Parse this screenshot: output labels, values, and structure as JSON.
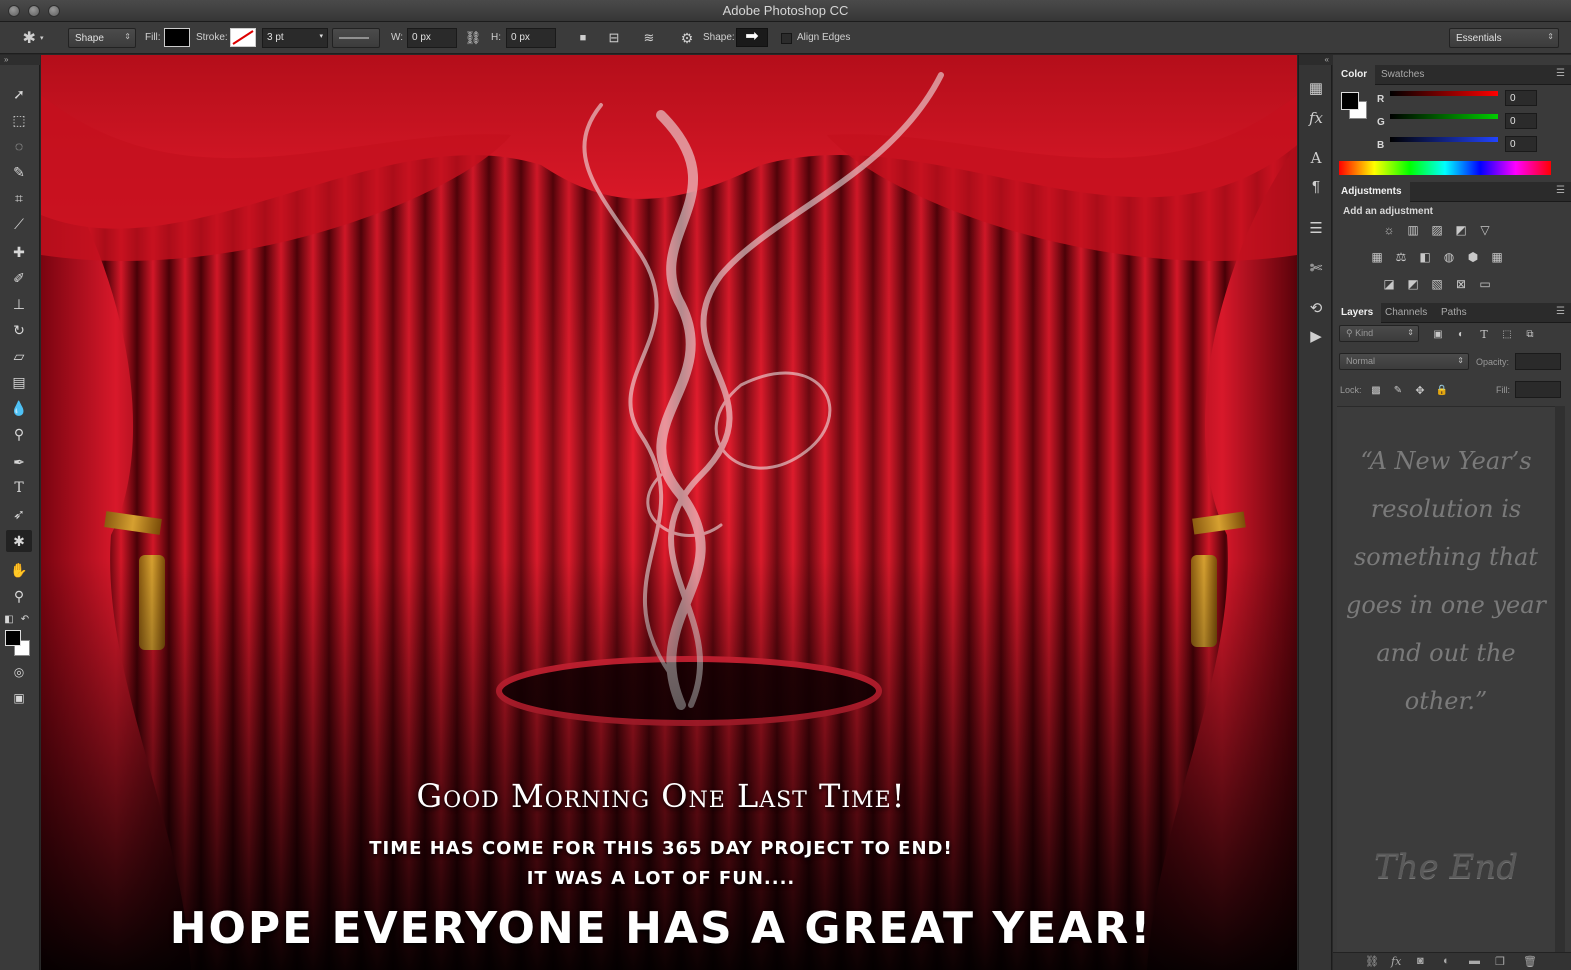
{
  "window": {
    "title": "Adobe Photoshop CC"
  },
  "options_bar": {
    "mode_label": "Shape",
    "fill_label": "Fill:",
    "stroke_label": "Stroke:",
    "stroke_size": "3 pt",
    "width_label": "W:",
    "width_value": "0 px",
    "height_label": "H:",
    "height_value": "0 px",
    "shape_label": "Shape:",
    "align_edges_label": "Align Edges",
    "workspace": "Essentials",
    "fill_color": "#000000"
  },
  "toolbar": {
    "tools": [
      "move-tool",
      "marquee-tool",
      "lasso-tool",
      "quick-select-tool",
      "crop-tool",
      "eyedropper-tool",
      "healing-brush-tool",
      "brush-tool",
      "clone-stamp-tool",
      "history-brush-tool",
      "eraser-tool",
      "gradient-tool",
      "blur-tool",
      "dodge-tool",
      "pen-tool",
      "type-tool",
      "path-select-tool",
      "custom-shape-tool",
      "hand-tool",
      "zoom-tool"
    ],
    "active_tool": "custom-shape-tool"
  },
  "canvas": {
    "heading": "Good Morning One Last Time!",
    "line1": "TIME HAS COME FOR THIS 365 DAY PROJECT TO END!",
    "line2": "IT WAS A LOT OF FUN....",
    "line3": "HOPE EVERYONE HAS A GREAT YEAR!",
    "curtain_color": "#c8101c"
  },
  "color_panel": {
    "tabs": [
      "Color",
      "Swatches"
    ],
    "active_tab": "Color",
    "channels": [
      {
        "label": "R",
        "value": "0"
      },
      {
        "label": "G",
        "value": "0"
      },
      {
        "label": "B",
        "value": "0"
      }
    ]
  },
  "adjustments_panel": {
    "tab": "Adjustments",
    "title": "Add an adjustment"
  },
  "layers_panel": {
    "tabs": [
      "Layers",
      "Channels",
      "Paths"
    ],
    "active_tab": "Layers",
    "filter_label": "Kind",
    "blend_mode": "Normal",
    "opacity_label": "Opacity:",
    "lock_label": "Lock:",
    "fill_label": "Fill:",
    "quote": "“A New Year’s resolution is something that goes in one year and out the other.”",
    "the_end": "The End"
  }
}
